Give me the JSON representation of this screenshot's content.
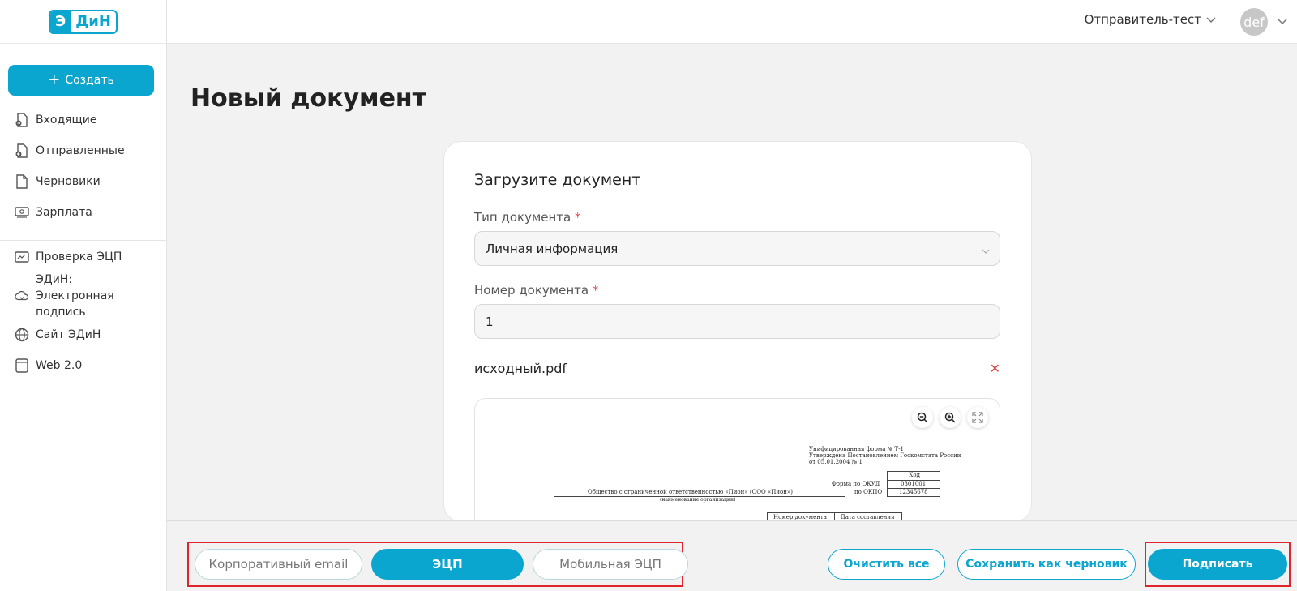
{
  "app": {
    "logo_part1": "Э",
    "logo_part2": "ДиН"
  },
  "sidebar": {
    "create_label": "Создать",
    "items": [
      {
        "label": "Входящие",
        "icon": "incoming-doc-icon"
      },
      {
        "label": "Отправленные",
        "icon": "sent-doc-icon"
      },
      {
        "label": "Черновики",
        "icon": "draft-doc-icon"
      },
      {
        "label": "Зарплата",
        "icon": "money-icon"
      },
      {
        "label": "Проверка ЭЦП",
        "icon": "signature-check-icon"
      },
      {
        "label": "ЭДиН: Электронная подпись",
        "icon": "cloud-sign-icon"
      },
      {
        "label": "Сайт ЭДиН",
        "icon": "globe-icon"
      },
      {
        "label": "Web 2.0",
        "icon": "window-icon"
      }
    ]
  },
  "header": {
    "sender": "Отправитель-тест",
    "avatar_text": "def"
  },
  "main": {
    "title": "Новый документ",
    "card_title": "Загрузите документ",
    "doc_type_label": "Тип документа",
    "doc_type_value": "Личная информация",
    "doc_number_label": "Номер документа",
    "doc_number_value": "1",
    "required_mark": "*",
    "file_name": "исходный.pdf",
    "remove_symbol": "✕"
  },
  "preview_doc": {
    "line1": "Унифицированная форма № Т-1",
    "line2": "Утверждена Постановлением Госкомстата России",
    "line3": "от 05.01.2004 № 1",
    "code_header": "Код",
    "okud_label": "Форма по ОКУД",
    "okud_value": "0301001",
    "okpo_label": "по ОКПО",
    "okpo_value": "12345678",
    "org_name": "Общество с ограниченной ответственностью «Пион» (ООО «Пион»)",
    "org_caption": "(наименование организации)",
    "col1": "Номер документа",
    "col2": "Дата составления"
  },
  "bottom": {
    "sign_method_1": "Корпоративный email",
    "sign_method_2": "ЭЦП",
    "sign_method_3": "Мобильная ЭЦП",
    "clear_all": "Очистить все",
    "save_draft": "Сохранить как черновик",
    "sign": "Подписать"
  },
  "colors": {
    "accent": "#0ba6cf",
    "highlight_frame": "#e0242e",
    "required": "#e04848"
  }
}
